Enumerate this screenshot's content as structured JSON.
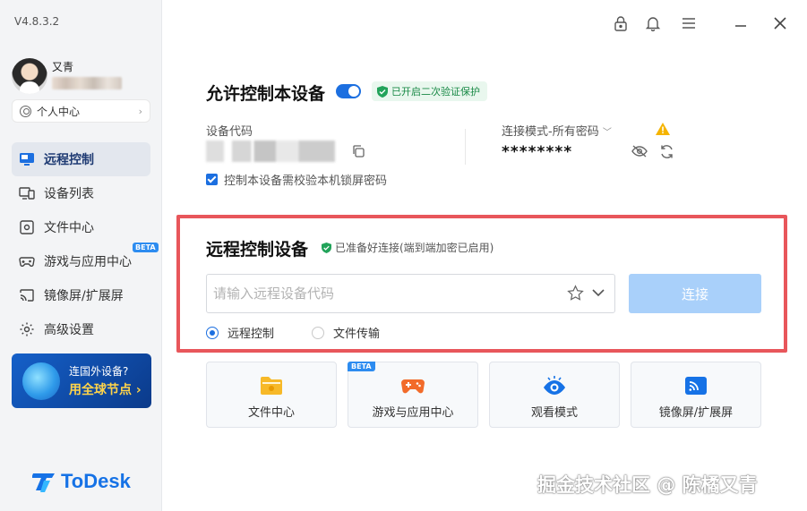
{
  "app": {
    "version": "V4.8.3.2",
    "brand": "ToDesk",
    "accent_color": "#1c6fe0"
  },
  "user": {
    "name": "又青",
    "personal_center": "个人中心"
  },
  "sidebar": {
    "items": [
      {
        "label": "远程控制",
        "icon": "monitor-icon",
        "active": true
      },
      {
        "label": "设备列表",
        "icon": "devices-icon"
      },
      {
        "label": "文件中心",
        "icon": "file-icon"
      },
      {
        "label": "游戏与应用中心",
        "icon": "gamepad-icon",
        "badge": "BETA"
      },
      {
        "label": "镜像屏/扩展屏",
        "icon": "cast-icon"
      },
      {
        "label": "高级设置",
        "icon": "gear-icon"
      }
    ],
    "promo": {
      "line1": "连国外设备?",
      "line2": "用全球节点 ›"
    }
  },
  "allow_control": {
    "title": "允许控制本设备",
    "toggle_on": true,
    "verify_tag": "已开启二次验证保护",
    "device_code_label": "设备代码",
    "mode_label": "连接模式-所有密码",
    "password": "********",
    "lock_screen_checkbox": "控制本设备需校验本机锁屏密码",
    "lock_screen_checked": true
  },
  "remote_control": {
    "title": "远程控制设备",
    "ready_text": "已准备好连接(端到端加密已启用)",
    "input_placeholder": "请输入远程设备代码",
    "connect_button": "连接",
    "options": [
      {
        "label": "远程控制",
        "selected": true
      },
      {
        "label": "文件传输",
        "selected": false
      }
    ]
  },
  "tiles": [
    {
      "label": "文件中心",
      "icon": "folder-icon"
    },
    {
      "label": "游戏与应用中心",
      "icon": "gamepad-icon",
      "badge": "BETA"
    },
    {
      "label": "观看模式",
      "icon": "eye-watch-icon"
    },
    {
      "label": "镜像屏/扩展屏",
      "icon": "cast-icon"
    }
  ],
  "watermark": "掘金技术社区 @ 陈橘又青"
}
